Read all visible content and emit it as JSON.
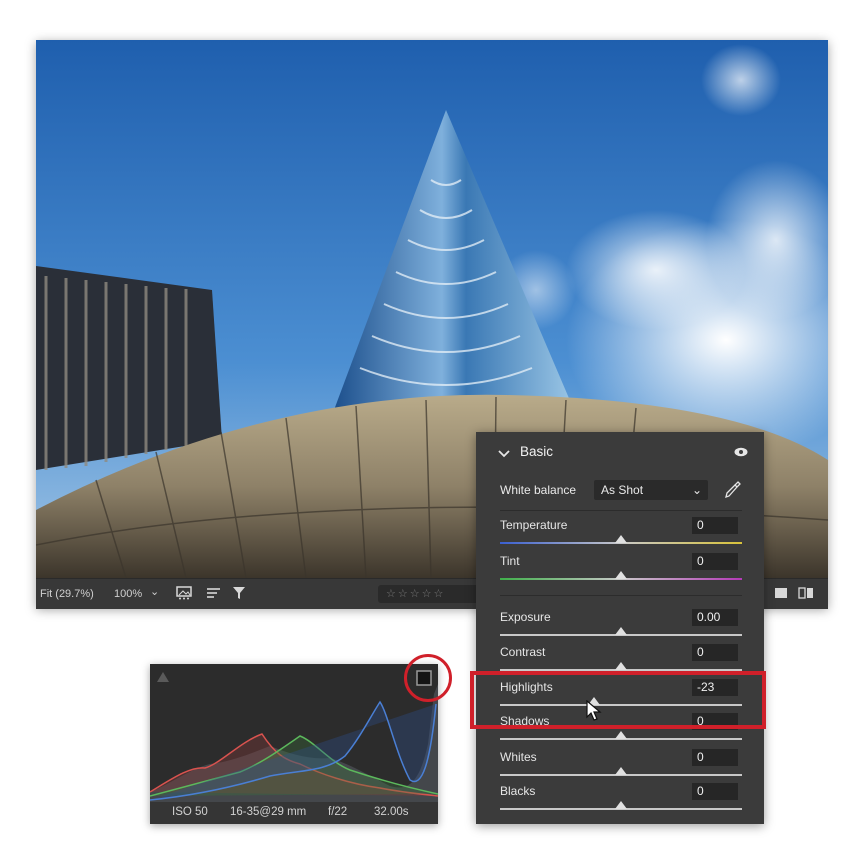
{
  "toolbar": {
    "fit_label": "Fit (29.7%)",
    "zoom_label": "100%",
    "zoom_caret": "⌄",
    "stars": "☆☆☆☆☆"
  },
  "histogram": {
    "iso": "ISO 50",
    "lens": "16-35@29 mm",
    "aperture": "f/22",
    "shutter": "32.00s"
  },
  "basic": {
    "title": "Basic",
    "white_balance_label": "White balance",
    "white_balance_value": "As Shot",
    "sliders": [
      {
        "label": "Temperature",
        "value": "0",
        "level": 0.5
      },
      {
        "label": "Tint",
        "value": "0",
        "level": 0.5
      },
      {
        "label": "Exposure",
        "value": "0.00",
        "level": 0.5
      },
      {
        "label": "Contrast",
        "value": "0",
        "level": 0.5
      },
      {
        "label": "Highlights",
        "value": "-23",
        "level": 0.39
      },
      {
        "label": "Shadows",
        "value": "0",
        "level": 0.5
      },
      {
        "label": "Whites",
        "value": "0",
        "level": 0.5
      },
      {
        "label": "Blacks",
        "value": "0",
        "level": 0.5
      }
    ]
  },
  "colors": {
    "highlight_outline": "#d0202a",
    "panel_bg": "#3b3b3b",
    "sky": "#2f6fb8"
  },
  "icons": [
    "chevron-down-icon",
    "eye-icon",
    "eyedropper-icon",
    "filter-icon",
    "sort-icon",
    "thumbnail-icon",
    "single-view-icon",
    "compare-view-icon",
    "cursor-icon",
    "warning-triangle-icon",
    "clipping-indicator-icon"
  ]
}
